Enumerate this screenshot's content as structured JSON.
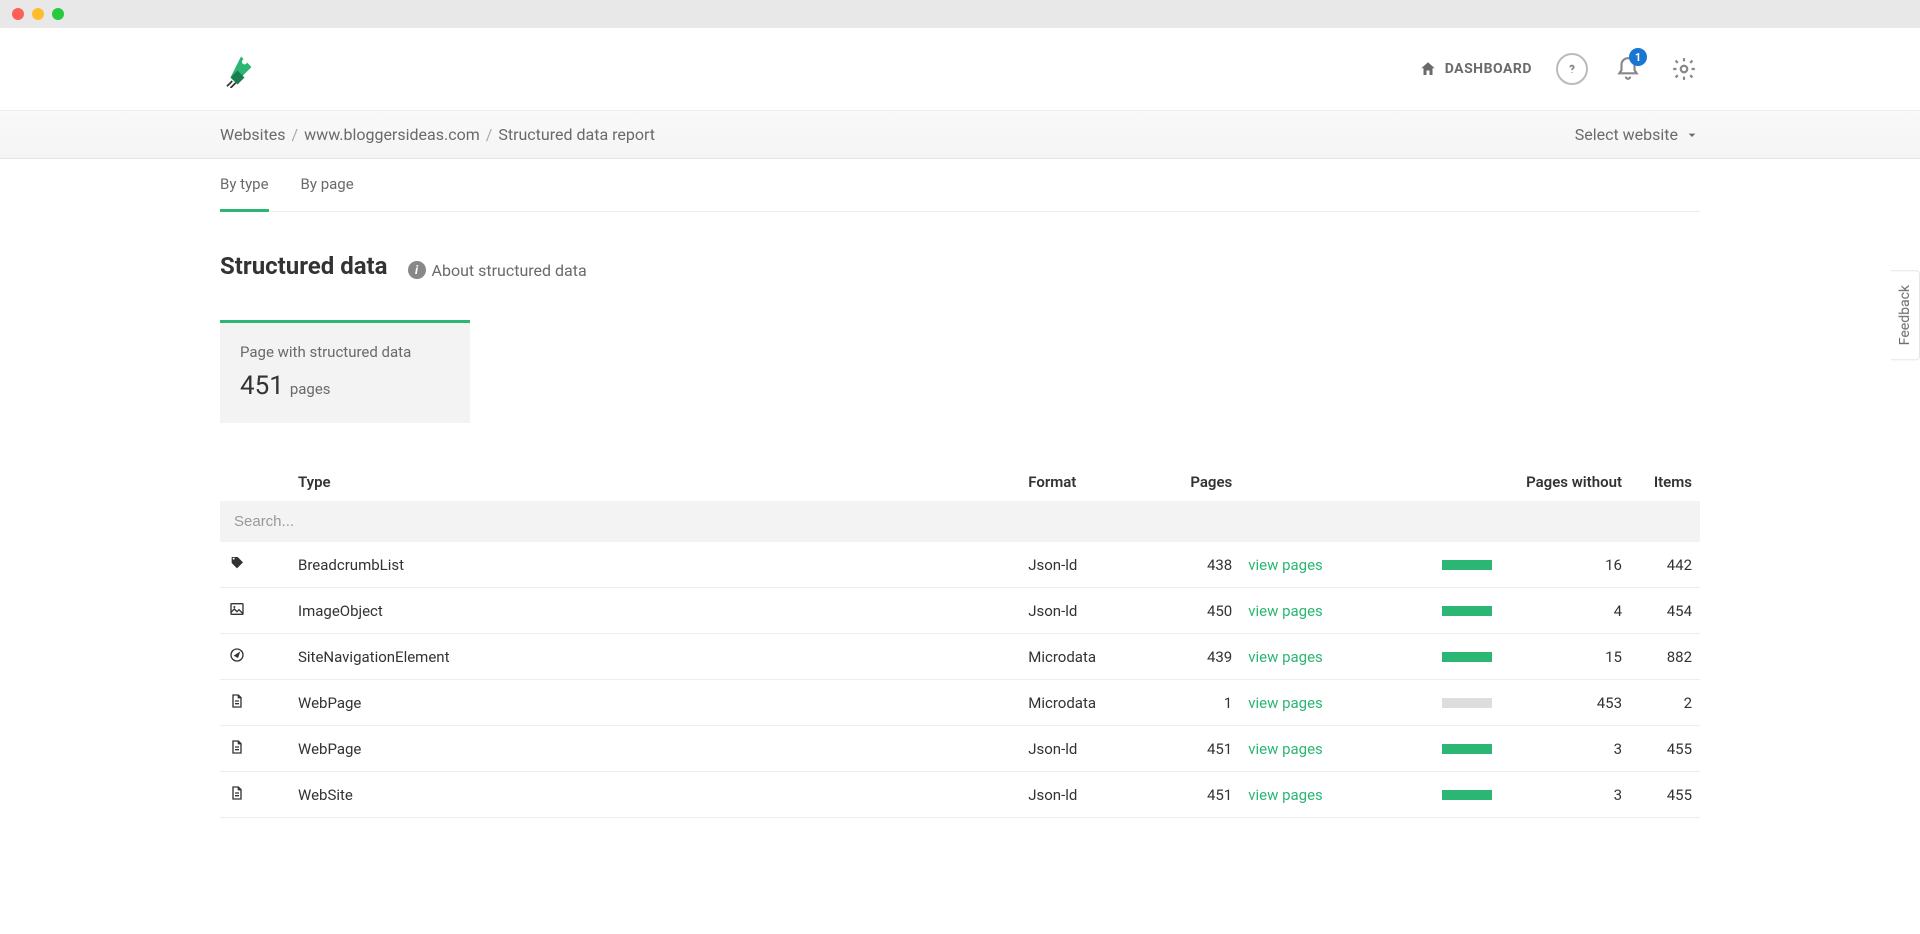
{
  "header": {
    "dashboard_label": "DASHBOARD",
    "notification_count": "1"
  },
  "breadcrumb": {
    "items": [
      "Websites",
      "www.bloggersideas.com",
      "Structured data report"
    ],
    "select_website_label": "Select website"
  },
  "tabs": [
    {
      "label": "By type",
      "active": true
    },
    {
      "label": "By page",
      "active": false
    }
  ],
  "page": {
    "title": "Structured data",
    "about_label": "About structured data"
  },
  "summary": {
    "label": "Page with structured data",
    "value": "451",
    "unit": "pages"
  },
  "table": {
    "headers": {
      "type": "Type",
      "format": "Format",
      "pages": "Pages",
      "pages_without": "Pages without",
      "items": "Items"
    },
    "search_placeholder": "Search...",
    "view_pages_label": "view pages",
    "rows": [
      {
        "icon": "tag-icon",
        "type": "BreadcrumbList",
        "format": "Json-ld",
        "pages": "438",
        "bar_filled": true,
        "pages_without": "16",
        "items": "442"
      },
      {
        "icon": "image-icon",
        "type": "ImageObject",
        "format": "Json-ld",
        "pages": "450",
        "bar_filled": true,
        "pages_without": "4",
        "items": "454"
      },
      {
        "icon": "compass-icon",
        "type": "SiteNavigationElement",
        "format": "Microdata",
        "pages": "439",
        "bar_filled": true,
        "pages_without": "15",
        "items": "882"
      },
      {
        "icon": "document-icon",
        "type": "WebPage",
        "format": "Microdata",
        "pages": "1",
        "bar_filled": false,
        "pages_without": "453",
        "items": "2"
      },
      {
        "icon": "document-icon",
        "type": "WebPage",
        "format": "Json-ld",
        "pages": "451",
        "bar_filled": true,
        "pages_without": "3",
        "items": "455"
      },
      {
        "icon": "document-icon",
        "type": "WebSite",
        "format": "Json-ld",
        "pages": "451",
        "bar_filled": true,
        "pages_without": "3",
        "items": "455"
      }
    ]
  },
  "feedback_label": "Feedback"
}
